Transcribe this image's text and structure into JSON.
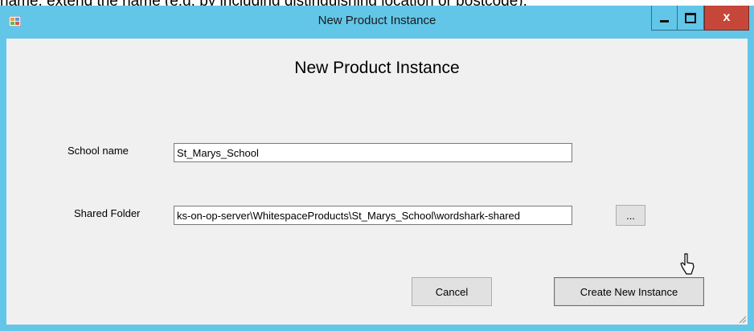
{
  "background": {
    "partial_text": "name, extend the name (e.g. by including distinguishing location or postcode)."
  },
  "window": {
    "title": "New Product Instance",
    "app_icon": "form-app-icon",
    "controls": {
      "close_symbol": "x"
    },
    "colors": {
      "titlebar": "#62c6e8",
      "close": "#c7463a",
      "client": "#f0f0f0"
    }
  },
  "form": {
    "heading": "New Product Instance",
    "school_name": {
      "label": "School name",
      "value": "St_Marys_School"
    },
    "shared_folder": {
      "label": "Shared Folder",
      "value": "\\\\ks-on-op-server\\WhitespaceProducts\\St_Marys_School\\wordshark-shared",
      "visible_value": "ks-on-op-server\\WhitespaceProducts\\St_Marys_School\\wordshark-shared",
      "browse_label": "..."
    },
    "cancel_label": "Cancel",
    "create_label": "Create New Instance"
  }
}
